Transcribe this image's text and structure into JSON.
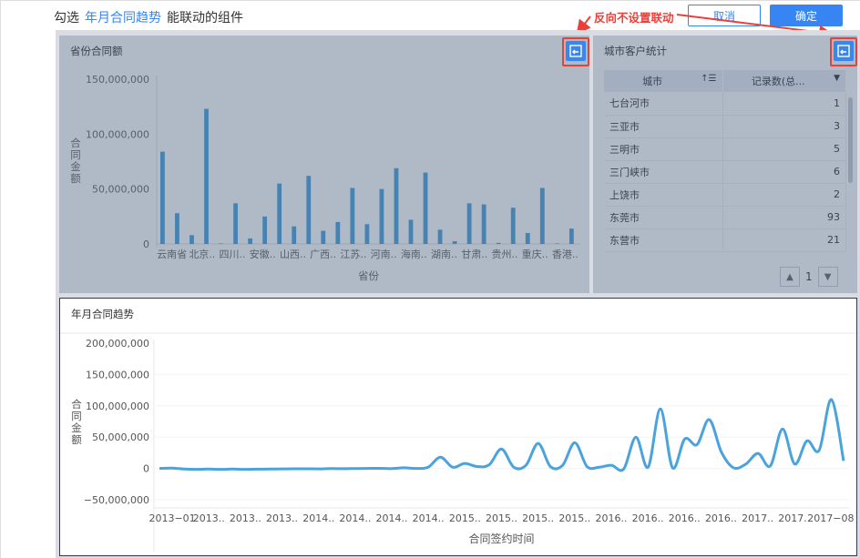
{
  "header": {
    "prefix": "勾选",
    "highlight": "年月合同趋势",
    "suffix": "能联动的组件"
  },
  "buttons": {
    "cancel": "取消",
    "ok": "确定"
  },
  "annotation": "反向不设置联动",
  "colors": {
    "accent": "#3685f2",
    "series": "#4aa3dc",
    "annotation": "#e8413c"
  },
  "province_chart": {
    "title": "省份合同额",
    "link_icon": "link-back-icon",
    "chart_data": {
      "type": "bar",
      "ylabel": "合同金额",
      "xlabel": "省份",
      "yticks": [
        "150,000,000",
        "100,000,000",
        "50,000,000",
        "0"
      ],
      "ylim": [
        0,
        150000000
      ],
      "tick_labels": [
        "云南省",
        "北京..",
        "四川..",
        "安徽..",
        "山西..",
        "广西..",
        "江苏..",
        "河南..",
        "海南..",
        "湖南..",
        "甘肃..",
        "贵州..",
        "重庆..",
        "香港.."
      ],
      "values": [
        84000000,
        28000000,
        8000000,
        123000000,
        500000,
        37000000,
        5000000,
        25000000,
        55000000,
        16000000,
        62000000,
        12000000,
        20000000,
        51000000,
        18000000,
        50000000,
        69000000,
        22000000,
        65000000,
        13000000,
        2500000,
        37000000,
        36000000,
        1000000,
        33000000,
        10000000,
        51000000,
        500000,
        14000000
      ]
    }
  },
  "city_table": {
    "title": "城市客户统计",
    "link_icon": "link-back-icon",
    "columns": [
      "城市",
      "记录数(总..."
    ],
    "rows": [
      [
        "七台河市",
        "1"
      ],
      [
        "三亚市",
        "3"
      ],
      [
        "三明市",
        "5"
      ],
      [
        "三门峡市",
        "6"
      ],
      [
        "上饶市",
        "2"
      ],
      [
        "东莞市",
        "93"
      ],
      [
        "东营市",
        "21"
      ]
    ],
    "page": "1"
  },
  "trend_chart": {
    "title": "年月合同趋势",
    "chart_data": {
      "type": "line",
      "ylabel": "合同金额",
      "xlabel": "合同签约时间",
      "yticks": [
        "200,000,000",
        "150,000,000",
        "100,000,000",
        "50,000,000",
        "0",
        "−50,000,000"
      ],
      "ylim": [
        -50000000,
        200000000
      ],
      "tick_labels": [
        "2013−01",
        "2013..",
        "2013..",
        "2013..",
        "2014..",
        "2014..",
        "2014..",
        "2014..",
        "2015..",
        "2015..",
        "2015..",
        "2015..",
        "2016..",
        "2016..",
        "2016..",
        "2016..",
        "2017..",
        "2017..",
        "2017−08"
      ],
      "values": [
        0,
        500000,
        -1000000,
        -1500000,
        -1000000,
        -1500000,
        -1000000,
        -1500000,
        -1200000,
        -1000000,
        -800000,
        -600000,
        -500000,
        -700000,
        -300000,
        -400000,
        -200000,
        0,
        200000,
        -300000,
        1000000,
        0,
        2000000,
        18000000,
        2000000,
        8000000,
        3000000,
        6000000,
        31000000,
        2000000,
        5000000,
        40000000,
        3000000,
        5000000,
        41000000,
        3000000,
        2000000,
        5000000,
        -1000000,
        50000000,
        2000000,
        95000000,
        1000000,
        47000000,
        38000000,
        78000000,
        26000000,
        1000000,
        7000000,
        24000000,
        4000000,
        63000000,
        7000000,
        44000000,
        29000000,
        110000000,
        12000000
      ]
    }
  }
}
